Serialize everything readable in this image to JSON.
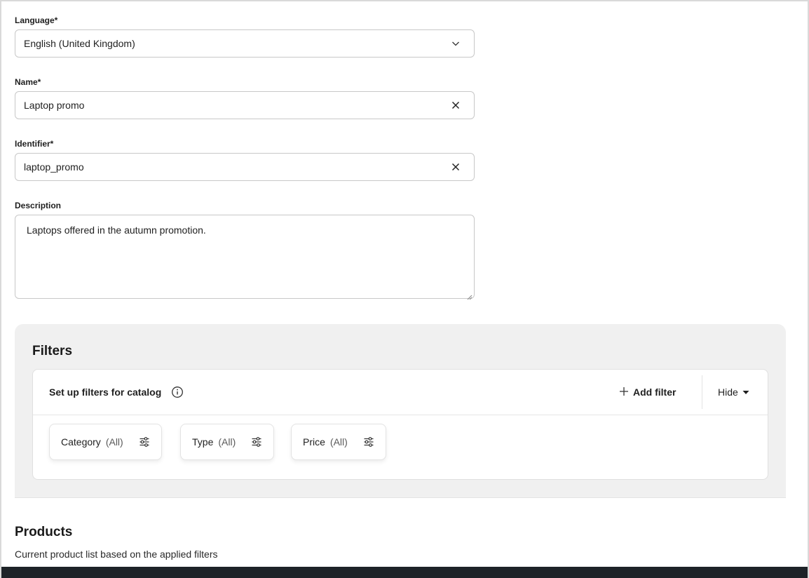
{
  "form": {
    "language": {
      "label": "Language*",
      "value": "English (United Kingdom)",
      "icon": "chevron-down-icon"
    },
    "name": {
      "label": "Name*",
      "value": "Laptop promo",
      "icon": "close-icon"
    },
    "identifier": {
      "label": "Identifier*",
      "value": "laptop_promo",
      "icon": "close-icon"
    },
    "description": {
      "label": "Description",
      "value": "Laptops offered in the autumn promotion."
    }
  },
  "filters": {
    "title": "Filters",
    "header_text": "Set up filters for catalog",
    "add_filter_label": "Add filter",
    "hide_label": "Hide",
    "chips": [
      {
        "name": "Category",
        "value": "(All)"
      },
      {
        "name": "Type",
        "value": "(All)"
      },
      {
        "name": "Price",
        "value": "(All)"
      }
    ]
  },
  "products": {
    "title": "Products",
    "subtitle": "Current product list based on the applied filters"
  },
  "colors": {
    "text": "#1f1f1f",
    "border": "#c8c8c8",
    "panel_bg": "#f0f0f0",
    "footer_bar": "#1e2328"
  }
}
